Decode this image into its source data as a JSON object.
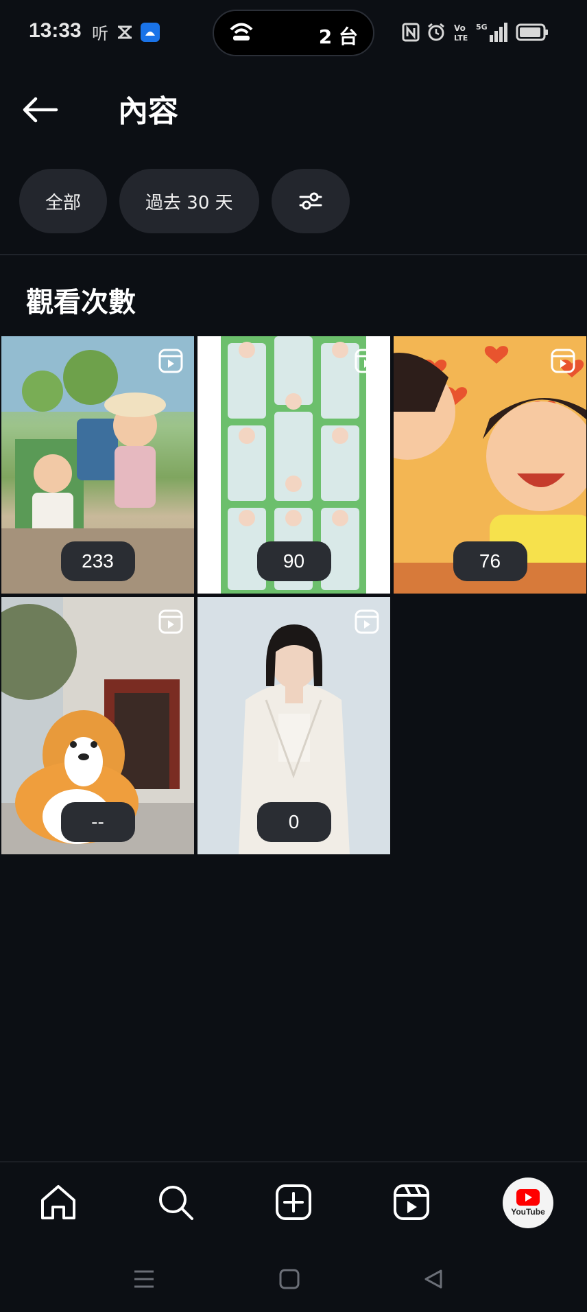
{
  "status_bar": {
    "time": "13:33",
    "island_count": "2 台"
  },
  "header": {
    "title": "內容"
  },
  "filters": {
    "all": "全部",
    "period": "過去 30 天"
  },
  "section": {
    "title": "觀看次數"
  },
  "videos": [
    {
      "views": "233"
    },
    {
      "views": "90"
    },
    {
      "views": "76"
    },
    {
      "views": "--"
    },
    {
      "views": "0"
    }
  ],
  "profile": {
    "avatar_text": "YouTube"
  },
  "colors": {
    "background": "#0c0f14",
    "chip": "#23262d",
    "badge": "#2a2d33",
    "youtube_red": "#ff0000"
  }
}
